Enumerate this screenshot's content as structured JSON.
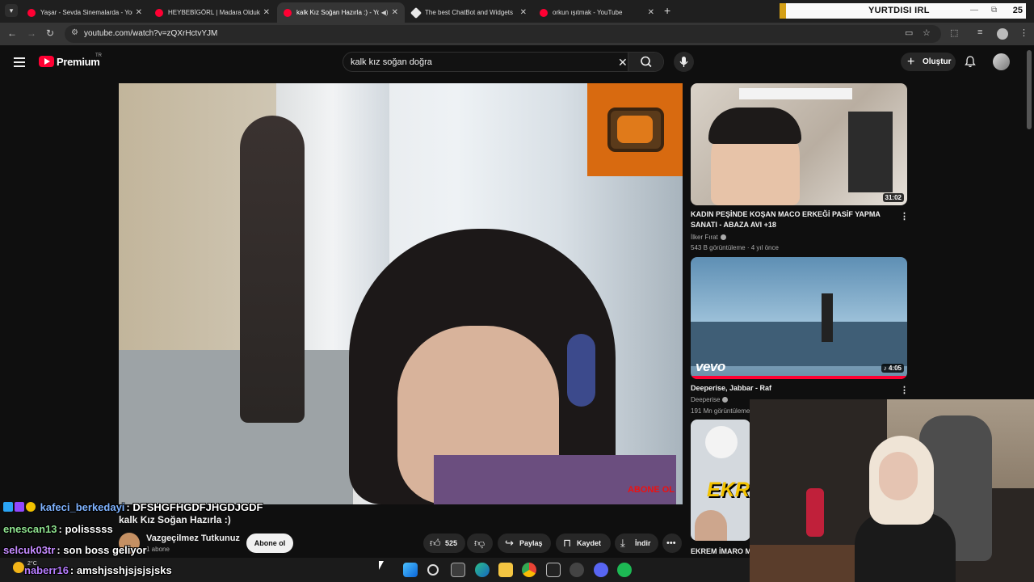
{
  "browser": {
    "tabs": [
      {
        "title": "Yaşar - Sevda Sinemalarda - You",
        "active": false
      },
      {
        "title": "HEYBEBİGÖRL | Madara Olduk",
        "active": false
      },
      {
        "title": "kalk Kız Soğan Hazırla :) - Yo",
        "active": true
      },
      {
        "title": "The best ChatBot and Widgets",
        "active": false
      },
      {
        "title": "orkun ışıtmak - YouTube",
        "active": false
      }
    ],
    "address": "youtube.com/watch?v=zQXrHctvYJM"
  },
  "stream_overlay": {
    "label": "YURTDISI IRL",
    "count": "25"
  },
  "youtube": {
    "brand": "Premium",
    "country": "TR",
    "search_value": "kalk kız soğan doğra",
    "create_label": "Oluştur"
  },
  "video": {
    "title": "kalk Kız Soğan Hazırla :)",
    "channel": "Vazgeçilmez Tutkunuz",
    "subscribers": "1 abone",
    "subscribe_label": "Abone ol",
    "likes": "525",
    "share_label": "Paylaş",
    "save_label": "Kaydet",
    "download_label": "İndir",
    "corner_logo": "ABONE OL"
  },
  "recommendations": [
    {
      "title": "KADIN PEŞİNDE KOŞAN MACO ERKEĞİ PASİF YAPMA SANATI - ABAZA AVI +18",
      "channel": "İlker Fırat",
      "meta": "543 B görüntüleme · 4 yıl önce",
      "duration": "31:02"
    },
    {
      "title": "Deeperise, Jabbar - Raf",
      "channel": "Deeperise",
      "meta": "191 Mn görüntüleme",
      "duration": "4:05",
      "thumb_text": "vevo"
    },
    {
      "title": "EKREM İMARO MU",
      "thumb_text": "EKR"
    }
  ],
  "chat": [
    {
      "user": "kafeci_berkedayi",
      "message": "DFSHGFHGDFJHGDJGDF",
      "color": "#7fb3ff"
    },
    {
      "user": "enescan13",
      "message": "polisssss",
      "color": "#8fe38f"
    },
    {
      "user": "selcuk03tr",
      "message": "son boss geliyor",
      "color": "#c58bff"
    },
    {
      "user": "naberr16",
      "message": "amshjsshjsjsjsjsks",
      "color": "#b77dff"
    }
  ],
  "taskbar": {
    "temperature": "2°C"
  }
}
